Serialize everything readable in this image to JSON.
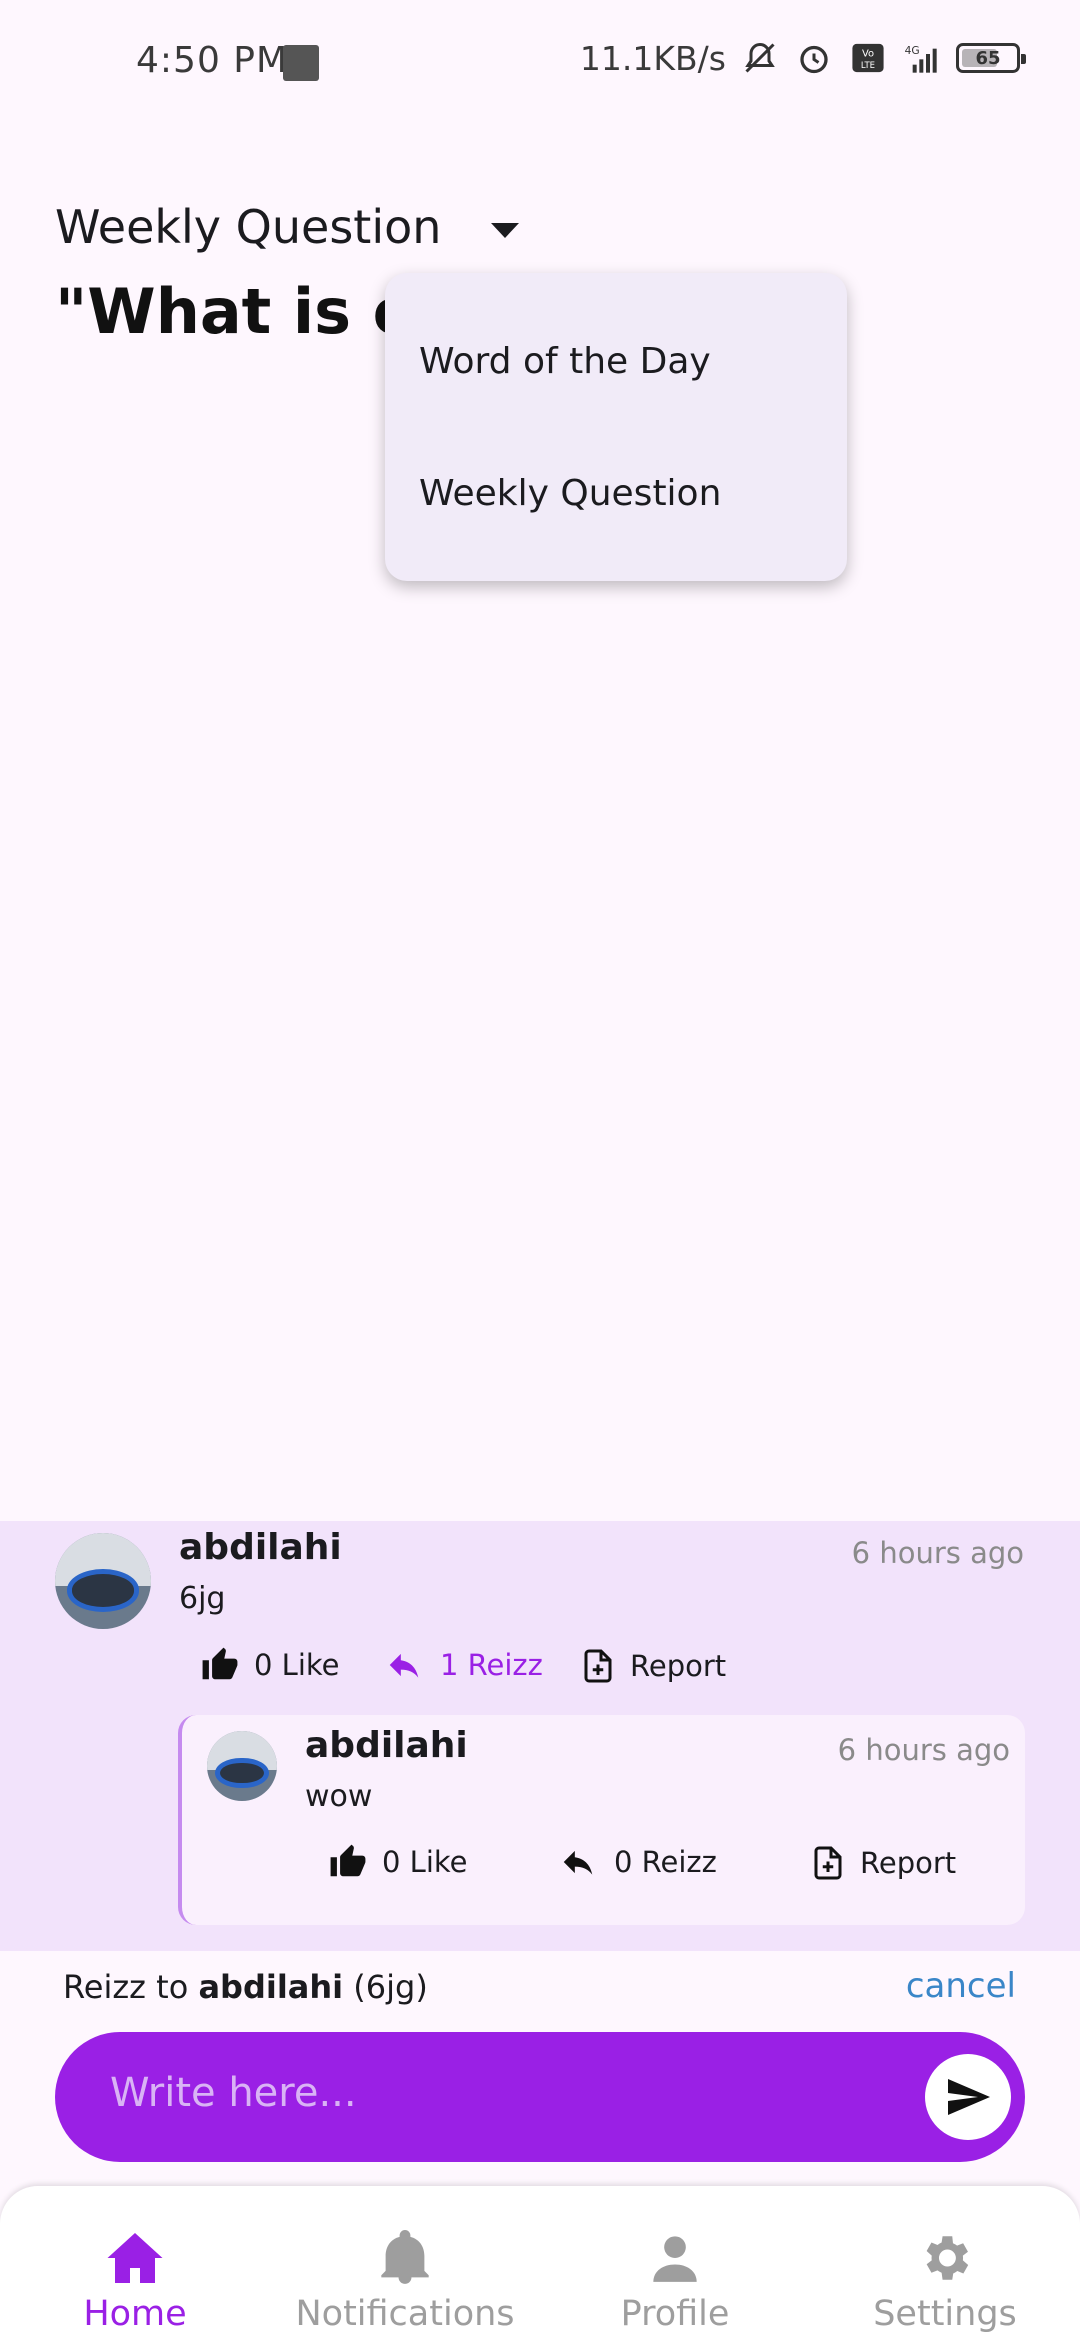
{
  "status_bar": {
    "time": "4:50 PM",
    "speed": "11.1KB/s",
    "battery": "65",
    "network": "4G"
  },
  "header": {
    "dropdown_label": "Weekly Question",
    "question_text": "\"What is one                           ...\""
  },
  "menu": {
    "items": [
      {
        "label": "Word of the Day"
      },
      {
        "label": "Weekly Question"
      }
    ]
  },
  "comments": [
    {
      "user": "abdilahi",
      "time_ago": "6 hours ago",
      "text": "6jg",
      "like": "0 Like",
      "reizz": "1 Reizz",
      "report": "Report",
      "replies": [
        {
          "user": "abdilahi",
          "time_ago": "6 hours ago",
          "text": "wow",
          "like": "0 Like",
          "reizz": "0 Reizz",
          "report": "Report"
        }
      ]
    }
  ],
  "reply_bar": {
    "prefix": "Reizz to",
    "target_user": "abdilahi",
    "target_text": "(6jg)",
    "cancel": "cancel",
    "placeholder": "Write here..."
  },
  "bottom_nav": {
    "items": [
      {
        "label": "Home",
        "icon": "home-icon",
        "active": true
      },
      {
        "label": "Notifications",
        "icon": "bell-icon",
        "active": false
      },
      {
        "label": "Profile",
        "icon": "person-icon",
        "active": false
      },
      {
        "label": "Settings",
        "icon": "gear-icon",
        "active": false
      }
    ]
  },
  "colors": {
    "accent": "#9A20E5",
    "background": "#FEF7FE",
    "comment_bg": "#F2E3FB",
    "link": "#3A86C8"
  }
}
